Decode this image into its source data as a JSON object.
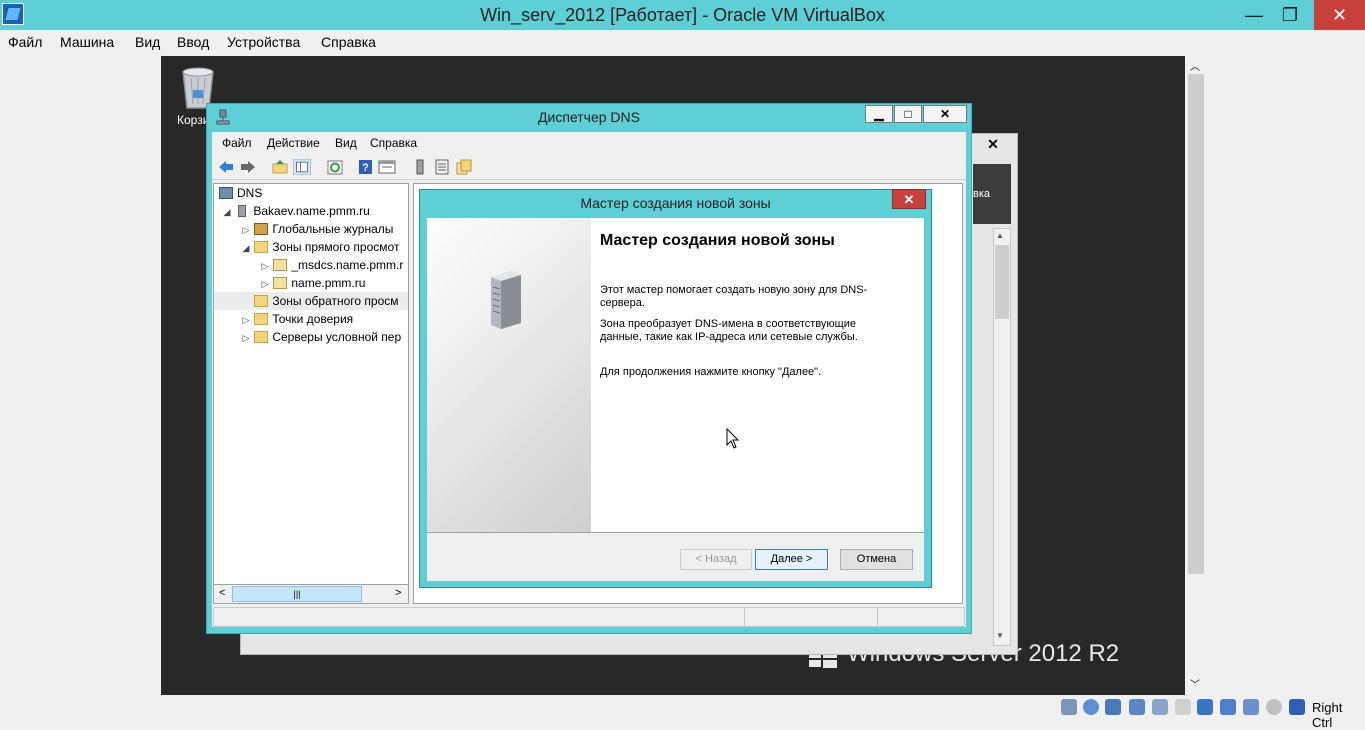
{
  "vbox": {
    "title": "Win_serv_2012 [Работает] - Oracle VM VirtualBox",
    "controls": {
      "minimize": "—",
      "maximize": "❐",
      "close": "✕"
    },
    "menu": [
      "Файл",
      "Машина",
      "Вид",
      "Ввод",
      "Устройства",
      "Справка"
    ],
    "host_key": "Right Ctrl",
    "status_icons": [
      "hdd-icon",
      "optical-icon",
      "audio-icon",
      "network-icon",
      "usb-icon",
      "shared-folder-icon",
      "display-icon",
      "video-capture-icon",
      "cpu-icon",
      "mouse-icon",
      "arrow-down-icon"
    ]
  },
  "guest": {
    "recycle_bin_label": "Корзи",
    "os_brand": "Windows Server 2012 R2",
    "background_window": {
      "close": "✕",
      "dark_label": "вка"
    },
    "dns_manager": {
      "title": "Диспетчер DNS",
      "controls": {
        "minimize": "▁",
        "maximize": "□",
        "close": "✕"
      },
      "menu": [
        "Файл",
        "Действие",
        "Вид",
        "Справка"
      ],
      "toolbar": [
        "back-arrow-icon",
        "forward-arrow-icon",
        "up-folder-icon",
        "show-hide-tree-icon",
        "refresh-icon",
        "help-icon",
        "properties-icon",
        "server-icon",
        "list-icon",
        "zone-icon"
      ],
      "tree": [
        {
          "label": "DNS",
          "level": 0,
          "icon": "dns-icon",
          "expander": ""
        },
        {
          "label": "Bakaev.name.pmm.ru",
          "level": 1,
          "icon": "server-icon",
          "expander": "◢"
        },
        {
          "label": "Глобальные журналы",
          "level": 2,
          "icon": "log-icon",
          "expander": "▷"
        },
        {
          "label": "Зоны прямого просмот",
          "level": 2,
          "icon": "folder-icon",
          "expander": "◢"
        },
        {
          "label": "_msdcs.name.pmm.r",
          "level": 3,
          "icon": "zone-icon",
          "expander": "▷"
        },
        {
          "label": "name.pmm.ru",
          "level": 3,
          "icon": "zone-icon",
          "expander": "▷"
        },
        {
          "label": "Зоны обратного просм",
          "level": 2,
          "icon": "folder-icon",
          "expander": "",
          "selected": true
        },
        {
          "label": "Точки доверия",
          "level": 2,
          "icon": "folder-icon",
          "expander": "▷"
        },
        {
          "label": "Серверы условной пер",
          "level": 2,
          "icon": "folder-icon",
          "expander": "▷"
        }
      ],
      "hscroll_left": "<",
      "hscroll_right": ">",
      "hscroll_grip": "|||"
    },
    "wizard": {
      "title": "Мастер создания новой зоны",
      "close": "✕",
      "heading": "Мастер создания новой зоны",
      "paragraph1": "Этот мастер помогает создать новую зону для DNS-сервера.",
      "paragraph2": "Зона преобразует DNS-имена в соответствующие данные, такие как IP-адреса или сетевые службы.",
      "paragraph3": "Для продолжения нажмите кнопку \"Далее\".",
      "buttons": {
        "back": "< Назад",
        "next": "Далее >",
        "cancel": "Отмена"
      }
    }
  }
}
